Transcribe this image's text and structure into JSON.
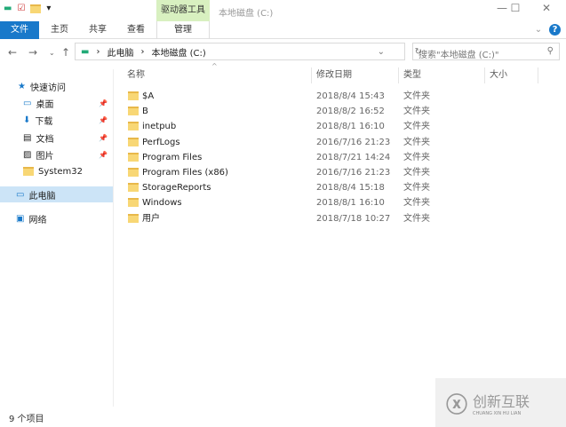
{
  "window": {
    "title": "本地磁盘 (C:)",
    "tool_tab": "驱动器工具",
    "minimize": "—",
    "maximize": "☐",
    "close": "✕"
  },
  "ribbon": {
    "tabs": [
      "文件",
      "主页",
      "共享",
      "查看",
      "管理"
    ],
    "help": "?",
    "expand": "⌄"
  },
  "address": {
    "path": [
      "此电脑",
      "本地磁盘 (C:)"
    ],
    "search_placeholder": "搜索\"本地磁盘 (C:)\""
  },
  "sidebar": {
    "items": [
      {
        "label": "快速访问",
        "icon": "star-icon"
      },
      {
        "label": "桌面",
        "icon": "desktop-icon",
        "pinned": true
      },
      {
        "label": "下载",
        "icon": "download-icon",
        "pinned": true
      },
      {
        "label": "文档",
        "icon": "document-icon",
        "pinned": true
      },
      {
        "label": "图片",
        "icon": "picture-icon",
        "pinned": true
      },
      {
        "label": "System32",
        "icon": "folder-icon"
      },
      {
        "label": "此电脑",
        "icon": "computer-icon",
        "selected": true
      },
      {
        "label": "网络",
        "icon": "network-icon"
      }
    ]
  },
  "columns": [
    "名称",
    "修改日期",
    "类型",
    "大小"
  ],
  "files": [
    {
      "name": "$A",
      "date": "2018/8/4 15:43",
      "type": "文件夹"
    },
    {
      "name": "B",
      "date": "2018/8/2 16:52",
      "type": "文件夹"
    },
    {
      "name": "inetpub",
      "date": "2018/8/1 16:10",
      "type": "文件夹"
    },
    {
      "name": "PerfLogs",
      "date": "2016/7/16 21:23",
      "type": "文件夹"
    },
    {
      "name": "Program Files",
      "date": "2018/7/21 14:24",
      "type": "文件夹"
    },
    {
      "name": "Program Files (x86)",
      "date": "2016/7/16 21:23",
      "type": "文件夹"
    },
    {
      "name": "StorageReports",
      "date": "2018/8/4 15:18",
      "type": "文件夹"
    },
    {
      "name": "Windows",
      "date": "2018/8/1 16:10",
      "type": "文件夹"
    },
    {
      "name": "用户",
      "date": "2018/7/18 10:27",
      "type": "文件夹"
    }
  ],
  "status": "9 个项目",
  "watermark": {
    "text": "创新互联",
    "sub": "CHUANG XIN HU LIAN"
  }
}
